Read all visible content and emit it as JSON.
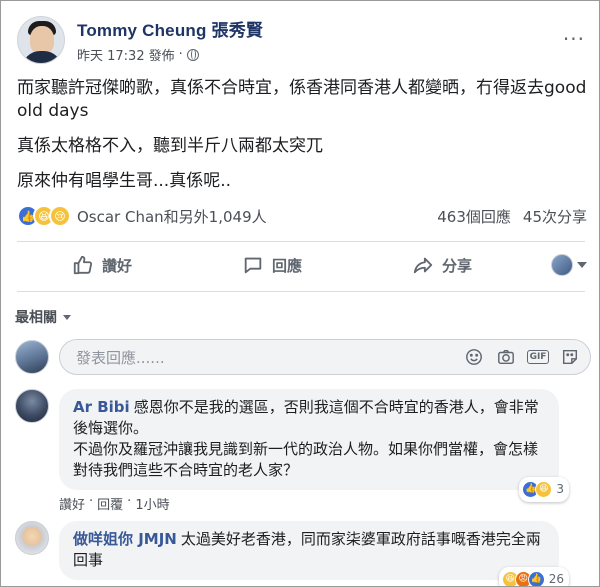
{
  "post": {
    "author": "Tommy Cheung 張秀賢",
    "time": "昨天 17:32",
    "privacy_label": "發佈",
    "paragraphs": [
      "而家聽許冠傑啲歌，真係不合時宜，係香港同香港人都變晒，冇得返去good old days",
      "真係太格格不入，聽到半斤八兩都太突兀",
      "原來仲有唱學生哥...真係呢.."
    ],
    "reaction_names": "Oscar Chan和另外1,049人",
    "comment_count": "463個回應",
    "share_count": "45次分享"
  },
  "actions": {
    "like": "讚好",
    "comment": "回應",
    "share": "分享"
  },
  "sort": {
    "label": "最相關"
  },
  "composer": {
    "placeholder": "發表回應......"
  },
  "comments": [
    {
      "name": "Ar Bibi",
      "text": "感恩你不是我的選區，否則我這個不合時宜的香港人，會非常後悔選你。",
      "text2": "不過你及羅冠沖讓我見識到新一代的政治人物。如果你們當權，會怎樣對待我們這些不合時宜的老人家？",
      "like_label": "讚好",
      "reply_label": "回覆",
      "time": "1小時",
      "reaction_count": "3"
    },
    {
      "name": "做咩姐你 JMJN",
      "text": "太過美好老香港，同而家柒婆軍政府話事嘅香港完全兩回事",
      "reaction_count": "26"
    }
  ],
  "colors": {
    "author": "#1f3566",
    "link": "#385898",
    "like_blue": "#3b6fd8",
    "emoji_yellow": "#f5c33b",
    "angry_orange": "#e9710f"
  },
  "icons": [
    "globe-icon",
    "more-icon",
    "like-icon",
    "comment-icon",
    "share-icon",
    "smiley-icon",
    "camera-icon",
    "gif-icon",
    "sticker-icon"
  ]
}
